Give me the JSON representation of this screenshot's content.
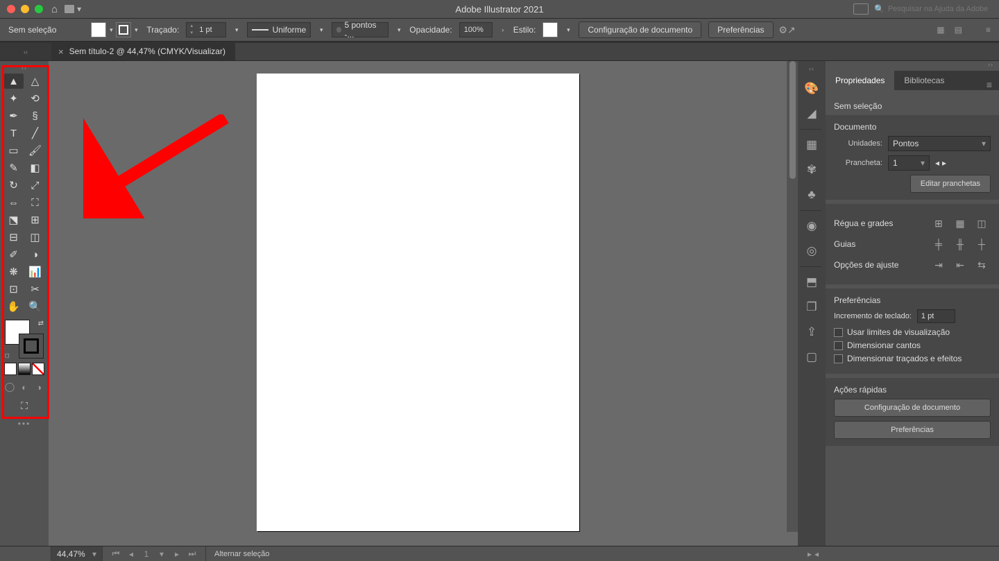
{
  "titlebar": {
    "app_title": "Adobe Illustrator 2021",
    "search_placeholder": "Pesquisar na Ajuda da Adobe"
  },
  "control": {
    "selection_state": "Sem seleção",
    "stroke_label": "Traçado:",
    "stroke_weight": "1 pt",
    "stroke_style": "Uniforme",
    "stroke_profile": "5 pontos -...",
    "opacity_label": "Opacidade:",
    "opacity_value": "100%",
    "style_label": "Estilo:",
    "doc_setup": "Configuração de documento",
    "preferences": "Preferências"
  },
  "doc_tab": {
    "close": "×",
    "title": "Sem título-2 @ 44,47% (CMYK/Visualizar)"
  },
  "toolbox": {
    "tools": [
      [
        "selection",
        "direct-selection"
      ],
      [
        "magic-wand",
        "lasso"
      ],
      [
        "pen",
        "curvature"
      ],
      [
        "type",
        "line"
      ],
      [
        "rectangle",
        "brush"
      ],
      [
        "shaper",
        "eraser"
      ],
      [
        "rotate",
        "scale"
      ],
      [
        "width",
        "free-transform"
      ],
      [
        "shape-builder",
        "perspective"
      ],
      [
        "mesh",
        "gradient"
      ],
      [
        "eyedropper",
        "blend"
      ],
      [
        "symbol-spray",
        "graph"
      ],
      [
        "artboard",
        "slice"
      ],
      [
        "hand",
        "zoom"
      ]
    ]
  },
  "tool_glyphs": {
    "selection": "▲",
    "direct-selection": "△",
    "magic-wand": "✦",
    "lasso": "⟲",
    "pen": "✒",
    "curvature": "§",
    "type": "T",
    "line": "╱",
    "rectangle": "▭",
    "brush": "🖌",
    "shaper": "✎",
    "eraser": "◧",
    "rotate": "↻",
    "scale": "⤢",
    "width": "⇔",
    "free-transform": "⛶",
    "shape-builder": "⬔",
    "perspective": "⊞",
    "mesh": "⊟",
    "gradient": "◫",
    "eyedropper": "✐",
    "blend": "◑",
    "symbol-spray": "❋",
    "graph": "📊",
    "artboard": "⊡",
    "slice": "✂",
    "hand": "✋",
    "zoom": "🔍"
  },
  "dock": {
    "icons": [
      "color",
      "color-guide",
      "swatches",
      "brushes",
      "symbols",
      "stroke",
      "appearance",
      "graphic-styles",
      "layers",
      "asset-export",
      "artboards"
    ]
  },
  "dock_glyphs": {
    "color": "🎨",
    "color-guide": "◢",
    "swatches": "▦",
    "brushes": "✾",
    "symbols": "♣",
    "stroke": "◉",
    "appearance": "◎",
    "graphic-styles": "⬒",
    "layers": "❐",
    "asset-export": "⇪",
    "artboards": "▢"
  },
  "dock_sep_after": [
    "color-guide",
    "symbols",
    "appearance"
  ],
  "panels": {
    "tab_properties": "Propriedades",
    "tab_libraries": "Bibliotecas",
    "selection_state": "Sem seleção",
    "doc_section": "Documento",
    "units_label": "Unidades:",
    "units_value": "Pontos",
    "artboard_label": "Prancheta:",
    "artboard_num": "1",
    "edit_artboards": "Editar pranchetas",
    "rulers_section": "Régua e grades",
    "guides_section": "Guias",
    "snap_section": "Opções de ajuste",
    "prefs_section": "Preferências",
    "keyboard_inc_label": "Incremento de teclado:",
    "keyboard_inc_val": "1 pt",
    "chk_preview": "Usar limites de visualização",
    "chk_corners": "Dimensionar cantos",
    "chk_strokes": "Dimensionar traçados e efeitos",
    "quick_section": "Ações rápidas",
    "qa_docsetup": "Configuração de documento",
    "qa_prefs": "Preferências"
  },
  "status": {
    "zoom": "44,47%",
    "artboard": "1",
    "hint": "Alternar seleção"
  }
}
